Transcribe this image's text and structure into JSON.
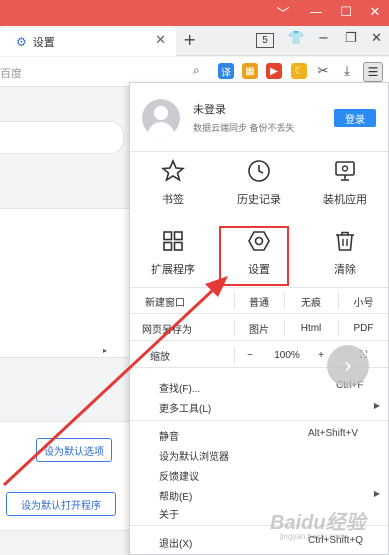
{
  "window": {
    "minimize": "﹀",
    "restore": "—",
    "maximize": "☐",
    "close": "✕",
    "titlebar_color": "#e85a53"
  },
  "tab": {
    "icon": "gear-icon",
    "title": "设置",
    "close": "✕",
    "new_tab": "+",
    "count": "5"
  },
  "address": {
    "text": "百度",
    "search_icon": "🔍"
  },
  "toolbar_icons": [
    {
      "name": "translate-icon",
      "glyph": "译",
      "color": "#2f86e6"
    },
    {
      "name": "apps-icon",
      "glyph": "▦",
      "color": "#e8a21c"
    },
    {
      "name": "video-icon",
      "glyph": "▶",
      "color": "#e2452c"
    },
    {
      "name": "night-mode-icon",
      "glyph": "☾",
      "color": "#f0b21d"
    },
    {
      "name": "scissors-icon",
      "glyph": "✂",
      "color": "#444444"
    },
    {
      "name": "download-icon",
      "glyph": "⤓",
      "color": "#444444"
    }
  ],
  "menu_button": "☰",
  "menu": {
    "user": {
      "name": "未登录",
      "desc": "数据云端同步 备份不丢失",
      "login": "登录"
    },
    "grid": [
      {
        "name": "bookmark-item",
        "icon": "star-icon",
        "label": "书签"
      },
      {
        "name": "history-item",
        "icon": "clock-icon",
        "label": "历史记录"
      },
      {
        "name": "install-app-item",
        "icon": "monitor-icon",
        "label": "装机应用"
      },
      {
        "name": "extensions-item",
        "icon": "grid-icon",
        "label": "扩展程序"
      },
      {
        "name": "settings-item",
        "icon": "hexagon-gear-icon",
        "label": "设置"
      },
      {
        "name": "clear-item",
        "icon": "trash-icon",
        "label": "清除"
      }
    ],
    "rows": {
      "new_window": "新建窗口",
      "normal": "普通",
      "incognito": "无痕",
      "small": "小号",
      "save_as": "网页另存为",
      "image": "图片",
      "html": "Html",
      "pdf": "PDF",
      "zoom": "缩放",
      "zoom_minus": "−",
      "zoom_value": "100%",
      "zoom_plus": "+",
      "fullscreen": "⛶"
    },
    "items": [
      {
        "label": "查找(F)...",
        "shortcut": "Ctrl+F",
        "submenu": false
      },
      {
        "label": "更多工具(L)",
        "shortcut": "",
        "submenu": true
      },
      {
        "label": "静音",
        "shortcut": "Alt+Shift+V",
        "submenu": false
      },
      {
        "label": "设为默认浏览器",
        "shortcut": "",
        "submenu": false
      },
      {
        "label": "反馈建议",
        "shortcut": "",
        "submenu": false
      },
      {
        "label": "帮助(E)",
        "shortcut": "",
        "submenu": true
      },
      {
        "label": "关于",
        "shortcut": "",
        "submenu": false
      },
      {
        "label": "退出(X)",
        "shortcut": "Ctrl+Shift+Q",
        "submenu": false
      }
    ]
  },
  "page": {
    "btn_default_options": "设为默认选项",
    "btn_default_program": "设为默认打开程序"
  },
  "fab_icon": "›",
  "watermark": "Baidu经验",
  "watermark_sub": "jingyan.baidu.com",
  "colors": {
    "accent": "#2a8cf3",
    "highlight": "#e53935"
  }
}
